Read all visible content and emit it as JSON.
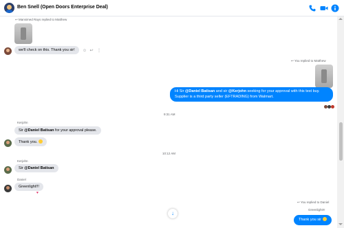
{
  "header": {
    "title": "Ben Snell (Open Doors Enterprise Deal)",
    "icons": [
      "phone-icon",
      "video-icon",
      "info-icon"
    ],
    "accent": "#0084ff"
  },
  "messages": {
    "reply_note_1": "Mansimed Rays replied to Matthew",
    "msg_1": "we'll check on this. Thank you sir!",
    "reply_note_2": "You replied to Matthew",
    "msg_2_parts": [
      "Hi Sir ",
      "@Daniel Batisan",
      " and sir ",
      "@Kerjohn",
      " seeking for your approval with this test buy. Supplier is a third party seller (EFTRADING) from Walmart."
    ],
    "time_1": "9:31 AM",
    "sender_1": "Kerjohn",
    "msg_3_parts": [
      "Sir ",
      "@Daniel Batisan",
      " for your approval please."
    ],
    "msg_4": "Thank you.",
    "time_2": "10:12 AM",
    "sender_2": "Kerjohn",
    "msg_5_parts": [
      "Sir ",
      "@Daniel Batisan"
    ],
    "sender_3": "Daniel",
    "msg_6": "Greenlight!!!",
    "reply_note_3": "You replied to Daniel",
    "quote_3": "Greenlight!!!",
    "msg_7": "Thank you sir"
  },
  "colors": {
    "outgoing_bubble": "#0084ff",
    "incoming_bubble": "#e4e6eb"
  }
}
